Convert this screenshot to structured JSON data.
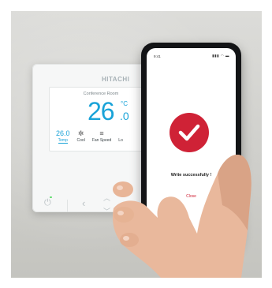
{
  "thermostat": {
    "brand": "HITACHI",
    "room": "Conference Room",
    "temperature_main": "26",
    "temperature_decimal": ".0",
    "unit": "°C",
    "items": [
      {
        "top": "26.0",
        "label": "Temp",
        "icon": "temp-value"
      },
      {
        "top": "✲",
        "label": "Cool",
        "icon": "snowflake-icon"
      },
      {
        "top": "≡",
        "label": "Fan Speed",
        "icon": "fan-speed-icon"
      },
      {
        "top": "",
        "label": "Lo",
        "icon": "louver-icon"
      }
    ],
    "buttons": {
      "power": "⏻",
      "left": "‹",
      "up": "︿",
      "down": "﹀"
    },
    "colors": {
      "accent": "#19a3d8",
      "led": "#5ddc6a"
    }
  },
  "phone": {
    "status_time": "9:41",
    "status_icons": "▮▮▮ ◠ ▬",
    "success_message": "Write successfully !",
    "close_label": "Close",
    "colors": {
      "accent": "#cf2236"
    }
  }
}
